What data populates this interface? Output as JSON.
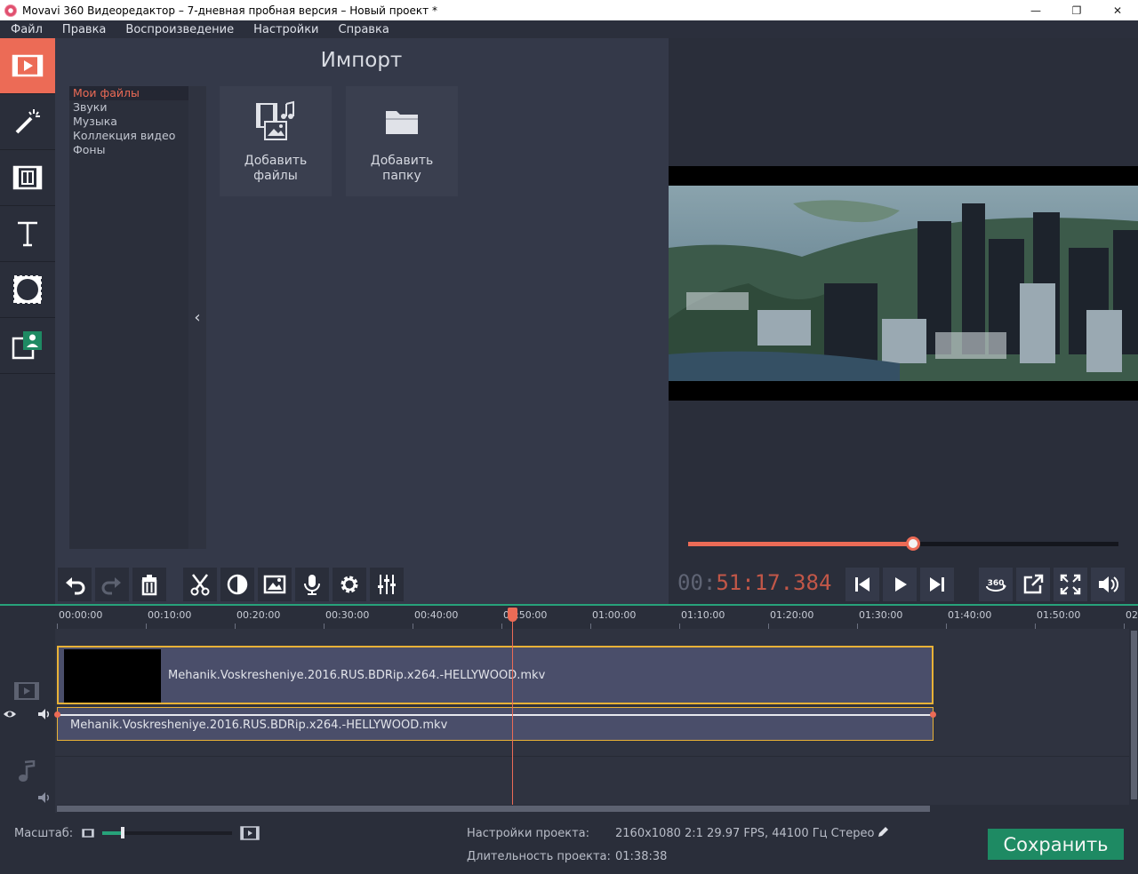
{
  "window": {
    "title": "Movavi 360 Видеоредактор – 7-дневная пробная версия – Новый проект *",
    "controls": {
      "minimize": "—",
      "maximize": "❐",
      "close": "✕"
    }
  },
  "menu": [
    "Файл",
    "Правка",
    "Воспроизведение",
    "Настройки",
    "Справка"
  ],
  "left_toolbar": [
    {
      "name": "import-tool",
      "icon": "film-import-icon",
      "active": true
    },
    {
      "name": "effects-tool",
      "icon": "magic-wand-icon",
      "active": false
    },
    {
      "name": "transitions-tool",
      "icon": "film-transition-icon",
      "active": false
    },
    {
      "name": "titles-tool",
      "icon": "text-t-icon",
      "active": false
    },
    {
      "name": "filters-tool",
      "icon": "checker-filter-icon",
      "active": false
    },
    {
      "name": "overlay-tool",
      "icon": "picture-in-picture-icon",
      "active": false
    }
  ],
  "import": {
    "title": "Импорт",
    "categories": [
      "Мои файлы",
      "Звуки",
      "Музыка",
      "Коллекция видео",
      "Фоны"
    ],
    "selected_category": "Мои файлы",
    "collapse_glyph": "‹",
    "tiles": [
      {
        "line1": "Добавить",
        "line2": "файлы",
        "icon": "add-files-icon"
      },
      {
        "line1": "Добавить",
        "line2": "папку",
        "icon": "add-folder-icon"
      }
    ]
  },
  "player": {
    "timecode_dim": "00:",
    "timecode_hi": "51:17.384",
    "progress": 0.523
  },
  "edit_toolbar": [
    "undo-icon",
    "redo-icon",
    "trash-icon",
    "scissors-icon",
    "color-adjust-icon",
    "image-icon",
    "microphone-icon",
    "gear-icon",
    "equalizer-icon"
  ],
  "timeline": {
    "ticks": [
      "00:00:00",
      "00:10:00",
      "00:20:00",
      "00:30:00",
      "00:40:00",
      "00:50:00",
      "01:00:00",
      "01:10:00",
      "01:20:00",
      "01:30:00",
      "01:40:00",
      "01:50:00",
      "02"
    ],
    "video_clip": "Mehanik.Voskresheniye.2016.RUS.BDRip.x264.-HELLYWOOD.mkv",
    "audio_clip": "Mehanik.Voskresheniye.2016.RUS.BDRip.x264.-HELLYWOOD.mkv"
  },
  "status": {
    "zoom_label": "Масштаб:",
    "zoom_level": 0.16,
    "settings_label": "Настройки проекта:",
    "settings_value": "2160x1080 2:1 29.97 FPS, 44100 Гц Стерео",
    "duration_label": "Длительность проекта:",
    "duration_value": "01:38:38",
    "save_label": "Сохранить"
  },
  "colors": {
    "accent": "#ec6b56",
    "save": "#1e8a63",
    "clip_border": "#e9b237"
  }
}
